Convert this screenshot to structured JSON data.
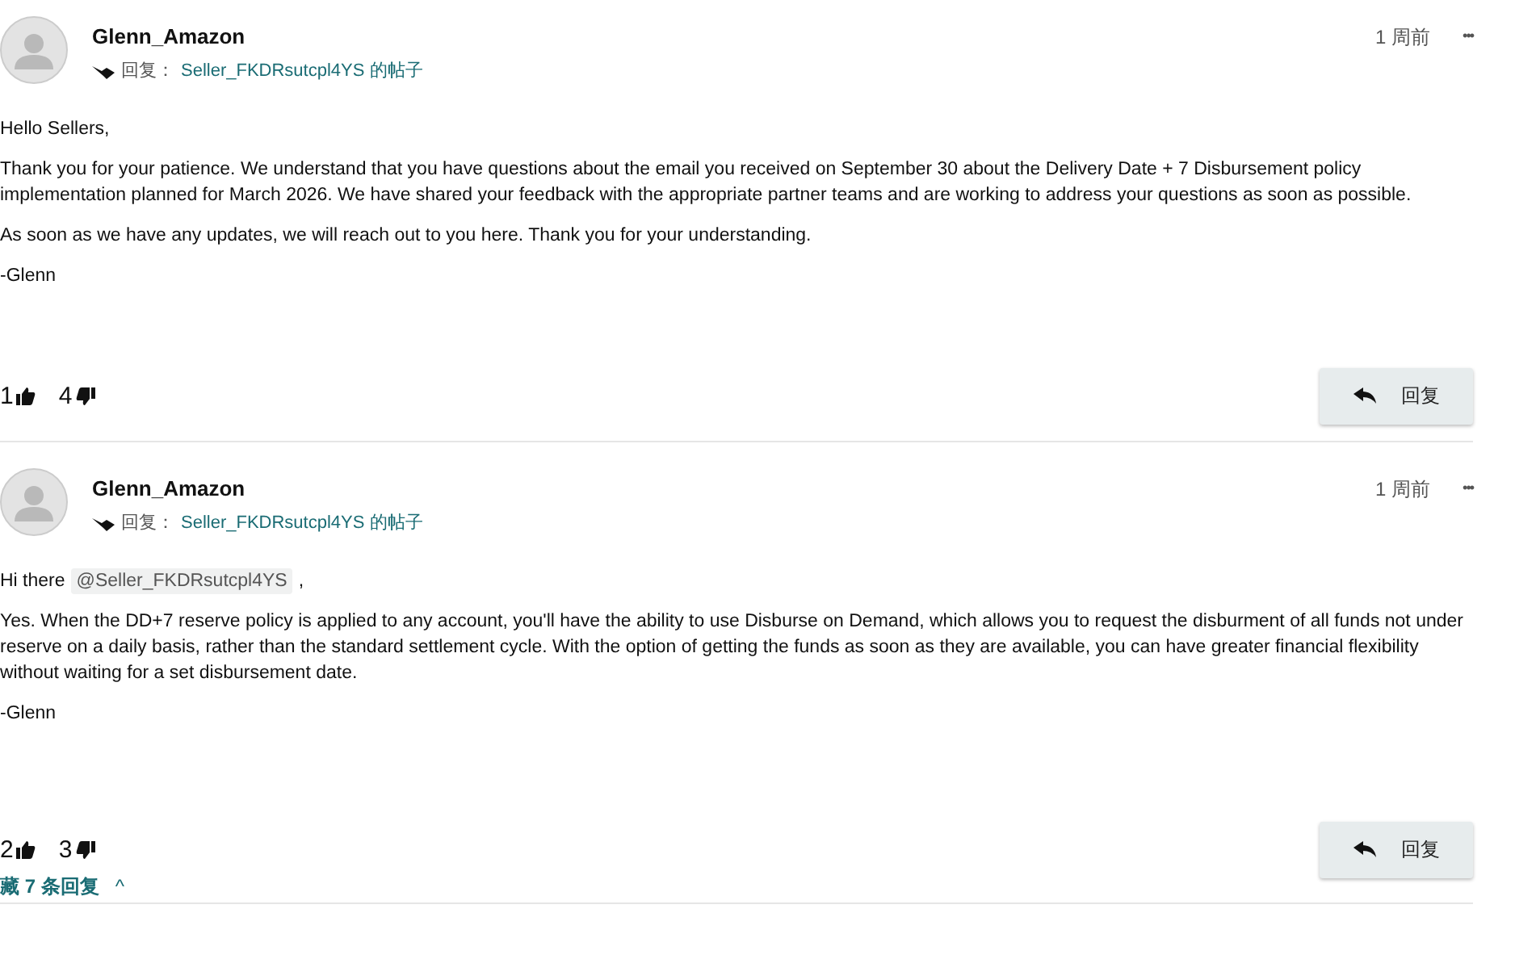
{
  "posts": [
    {
      "author": "Glenn_Amazon",
      "reply_label": "回复：",
      "reply_to": "Seller_FKDRsutcpl4YS 的帖子",
      "time": "1 周前",
      "more": "•••",
      "paragraphs": [
        {
          "kind": "text",
          "text": "Hello Sellers,"
        },
        {
          "kind": "text",
          "text": "Thank you for your patience. We understand that you have questions about the email you received on September 30 about the Delivery Date + 7 Disbursement policy implementation planned for March 2026. We have shared your feedback with the appropriate partner teams and are working to address your questions as soon as possible."
        },
        {
          "kind": "text",
          "text": "As soon as we have any updates, we will reach out to you here. Thank you for your understanding."
        },
        {
          "kind": "text",
          "text": "-Glenn"
        }
      ],
      "likes": "1",
      "dislikes": "4",
      "reply_button": "回复"
    },
    {
      "author": "Glenn_Amazon",
      "reply_label": "回复：",
      "reply_to": "Seller_FKDRsutcpl4YS 的帖子",
      "time": "1 周前",
      "more": "•••",
      "paragraphs": [
        {
          "kind": "mention",
          "before": "Hi there",
          "mention": "@Seller_FKDRsutcpl4YS",
          "after": ","
        },
        {
          "kind": "text",
          "text": "Yes. When the DD+7 reserve policy is applied to any account, you'll have the ability to use Disburse on Demand, which allows you to request the disburment of all funds not under reserve on a daily basis, rather than the standard settlement cycle. With the option of getting the funds as soon as they are available, you can have greater financial flexibility without waiting for a set disbursement date."
        },
        {
          "kind": "text",
          "text": "-Glenn"
        }
      ],
      "likes": "2",
      "dislikes": "3",
      "reply_button": "回复"
    }
  ],
  "collapse_link": "藏 7 条回复",
  "collapse_caret": "^"
}
